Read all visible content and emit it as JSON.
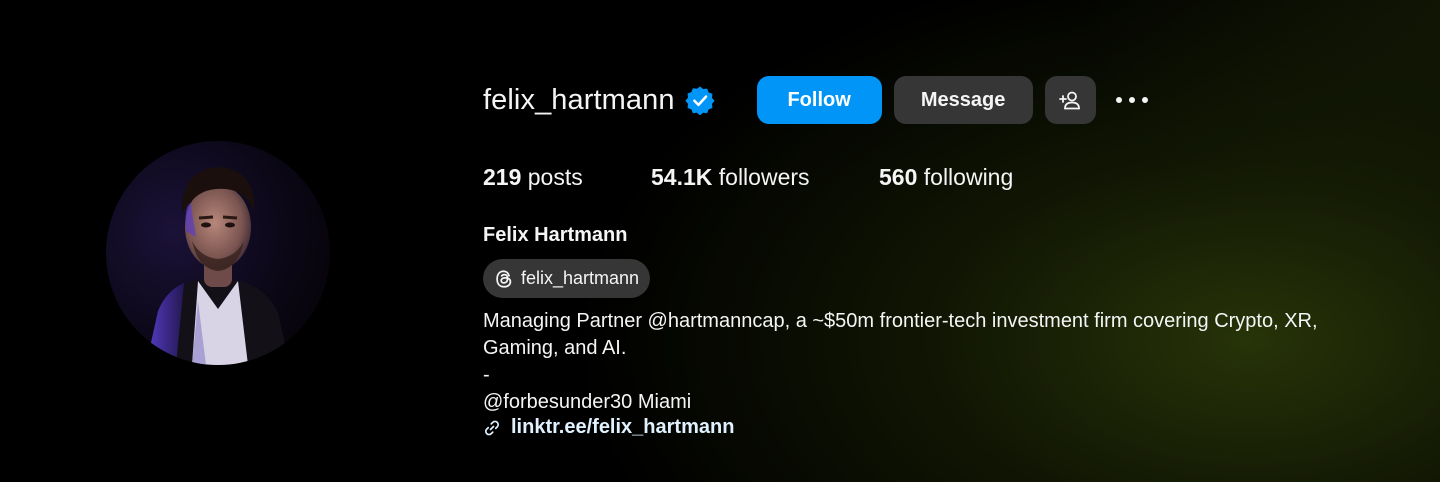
{
  "profile": {
    "username": "felix_hartmann",
    "verified": true,
    "full_name": "Felix Hartmann",
    "threads_handle": "felix_hartmann",
    "bio_lines": [
      "Managing Partner @hartmanncap, a ~$50m frontier-tech investment firm covering Crypto, XR,",
      "Gaming, and AI.",
      "-",
      "@forbesunder30 Miami"
    ],
    "link": "linktr.ee/felix_hartmann"
  },
  "actions": {
    "follow_label": "Follow",
    "message_label": "Message",
    "add_user_icon": "person-add-icon",
    "more_icon": "more-options-icon"
  },
  "stats": {
    "posts_count": "219",
    "posts_label": " posts",
    "followers_count": "54.1K",
    "followers_label": " followers",
    "following_count": "560",
    "following_label": " following"
  },
  "colors": {
    "follow_button": "#0095f6",
    "secondary_button": "#363636",
    "verified_badge": "#0095f6",
    "link": "#e0f1ff"
  }
}
